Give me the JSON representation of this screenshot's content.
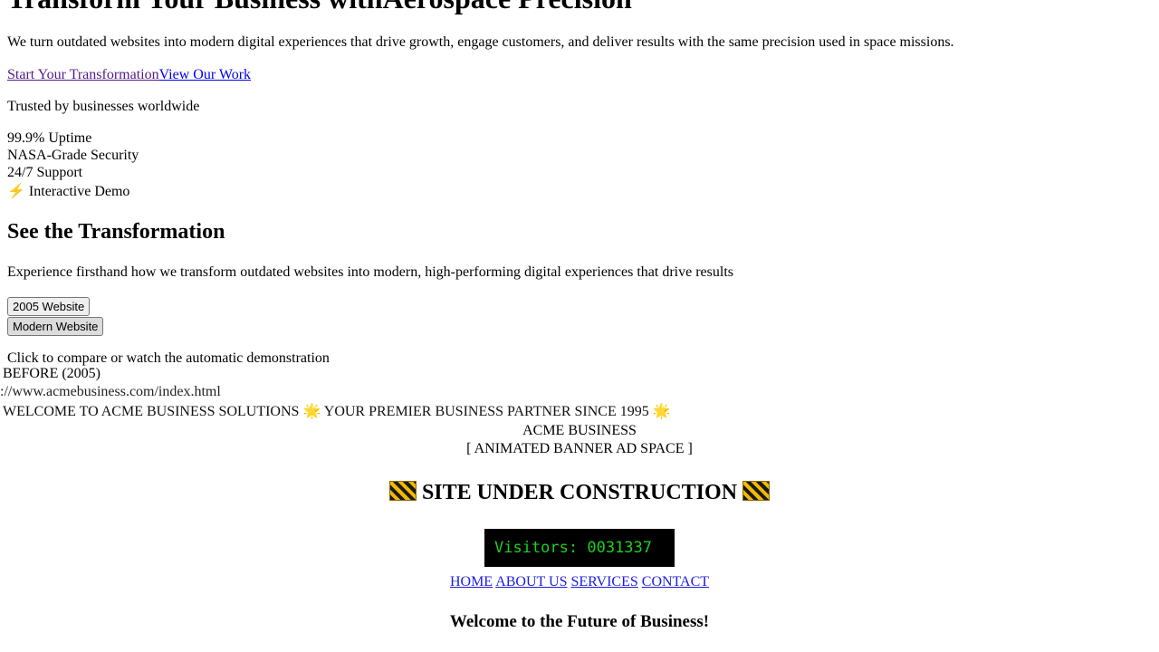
{
  "hero": {
    "title": "Transform Your Business withAerospace Precision",
    "subtitle": "We turn outdated websites into modern digital experiences that drive growth, engage customers, and deliver results with the same precision used in space missions.",
    "cta_primary": "Start Your Transformation",
    "cta_secondary": "View Our Work",
    "trusted": "Trusted by businesses worldwide"
  },
  "stats": [
    "99.9% Uptime",
    "NASA-Grade Security",
    "24/7 Support"
  ],
  "demo_badge": {
    "icon": "lightning-icon",
    "label": "Interactive Demo"
  },
  "transformation": {
    "title": "See the Transformation",
    "description": "Experience firsthand how we transform outdated websites into modern, high-performing digital experiences that drive results",
    "buttons": [
      "2005 Website",
      "Modern Website"
    ],
    "active_button": "2005 Website",
    "hint": "Click to compare or watch the automatic demonstration"
  },
  "before_label": "BEFORE (2005)",
  "old_site": {
    "url": "p://www.acmebusiness.com/index.html",
    "marquee_left": "WELCOME TO ACME BUSINESS SOLUTIONS",
    "marquee_right": "YOUR PREMIER BUSINESS PARTNER SINCE 1995",
    "company": "ACME BUSINESS",
    "banner": "[ ANIMATED BANNER AD SPACE ]",
    "construction": "SITE UNDER CONSTRUCTION",
    "counter": "Visitors: 0031337",
    "nav": [
      "HOME",
      "ABOUT US",
      "SERVICES",
      "CONTACT"
    ],
    "welcome": "Welcome to the Future of Business!"
  },
  "colors": {
    "link": "#0000ee",
    "visited_link": "#551a8b",
    "counter_bg": "#000000",
    "counter_text": "#1cd11c",
    "star": "#f2b01e"
  }
}
